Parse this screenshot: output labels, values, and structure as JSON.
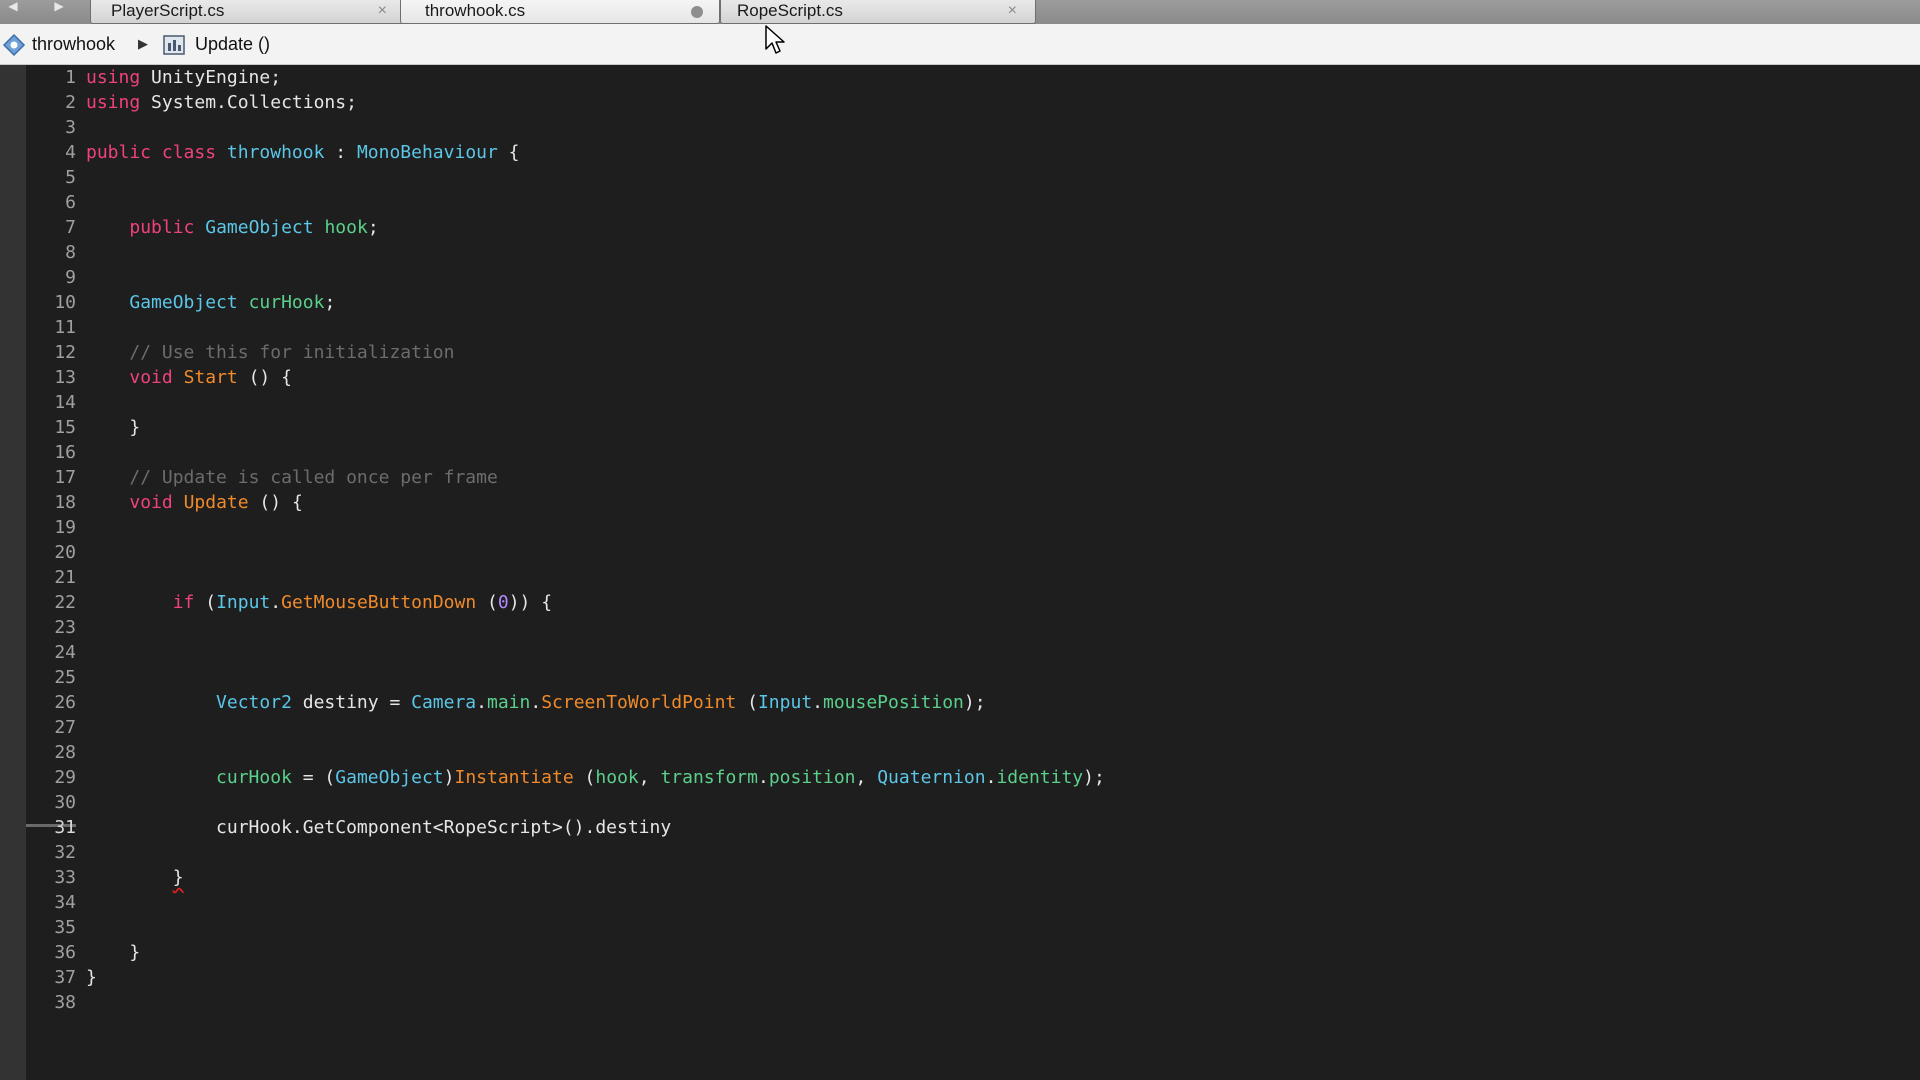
{
  "tabs": [
    {
      "label": "PlayerScript.cs",
      "close": "×"
    },
    {
      "label": "throwhook.cs",
      "modified": true
    },
    {
      "label": "RopeScript.cs",
      "close": "×"
    }
  ],
  "nav": {
    "back": "◀",
    "forward": "▶"
  },
  "breadcrumb": {
    "class_name": "throwhook",
    "separator": "▶",
    "method_name": "Update ()"
  },
  "icons": {
    "class_icon": "class-icon",
    "method_icon": "method-icon"
  },
  "colors": {
    "keyword": "#f0427a",
    "type": "#5bc6e6",
    "method": "#f08a2a",
    "field": "#5ad08b",
    "comment": "#6c6c6c",
    "number": "#b388ff"
  },
  "editor": {
    "current_line": 31,
    "lines": [
      [
        {
          "c": "k",
          "t": "using"
        },
        {
          "c": "p",
          "t": " UnityEngine;"
        }
      ],
      [
        {
          "c": "k",
          "t": "using"
        },
        {
          "c": "p",
          "t": " System.Collections;"
        }
      ],
      [],
      [
        {
          "c": "k",
          "t": "public class"
        },
        {
          "c": "p",
          "t": " "
        },
        {
          "c": "t",
          "t": "throwhook"
        },
        {
          "c": "p",
          "t": " : "
        },
        {
          "c": "t",
          "t": "MonoBehaviour"
        },
        {
          "c": "p",
          "t": " {"
        }
      ],
      [],
      [],
      [
        {
          "c": "p",
          "t": "    "
        },
        {
          "c": "k",
          "t": "public"
        },
        {
          "c": "p",
          "t": " "
        },
        {
          "c": "t",
          "t": "GameObject"
        },
        {
          "c": "p",
          "t": " "
        },
        {
          "c": "f",
          "t": "hook"
        },
        {
          "c": "p",
          "t": ";"
        }
      ],
      [],
      [],
      [
        {
          "c": "p",
          "t": "    "
        },
        {
          "c": "t",
          "t": "GameObject"
        },
        {
          "c": "p",
          "t": " "
        },
        {
          "c": "f",
          "t": "curHook"
        },
        {
          "c": "p",
          "t": ";"
        }
      ],
      [],
      [
        {
          "c": "p",
          "t": "    "
        },
        {
          "c": "c",
          "t": "// Use this for initialization"
        }
      ],
      [
        {
          "c": "p",
          "t": "    "
        },
        {
          "c": "k",
          "t": "void"
        },
        {
          "c": "p",
          "t": " "
        },
        {
          "c": "m",
          "t": "Start"
        },
        {
          "c": "p",
          "t": " () {"
        }
      ],
      [],
      [
        {
          "c": "p",
          "t": "    }"
        }
      ],
      [],
      [
        {
          "c": "p",
          "t": "    "
        },
        {
          "c": "c",
          "t": "// Update is called once per frame"
        }
      ],
      [
        {
          "c": "p",
          "t": "    "
        },
        {
          "c": "k",
          "t": "void"
        },
        {
          "c": "p",
          "t": " "
        },
        {
          "c": "m",
          "t": "Update"
        },
        {
          "c": "p",
          "t": " () {"
        }
      ],
      [],
      [],
      [],
      [
        {
          "c": "p",
          "t": "        "
        },
        {
          "c": "k",
          "t": "if"
        },
        {
          "c": "p",
          "t": " ("
        },
        {
          "c": "t",
          "t": "Input"
        },
        {
          "c": "p",
          "t": "."
        },
        {
          "c": "m",
          "t": "GetMouseButtonDown"
        },
        {
          "c": "p",
          "t": " ("
        },
        {
          "c": "n",
          "t": "0"
        },
        {
          "c": "p",
          "t": ")) {"
        }
      ],
      [],
      [],
      [],
      [
        {
          "c": "p",
          "t": "            "
        },
        {
          "c": "t",
          "t": "Vector2"
        },
        {
          "c": "p",
          "t": " destiny = "
        },
        {
          "c": "t",
          "t": "Camera"
        },
        {
          "c": "p",
          "t": "."
        },
        {
          "c": "f",
          "t": "main"
        },
        {
          "c": "p",
          "t": "."
        },
        {
          "c": "m",
          "t": "ScreenToWorldPoint"
        },
        {
          "c": "p",
          "t": " ("
        },
        {
          "c": "t",
          "t": "Input"
        },
        {
          "c": "p",
          "t": "."
        },
        {
          "c": "f",
          "t": "mousePosition"
        },
        {
          "c": "p",
          "t": ");"
        }
      ],
      [],
      [],
      [
        {
          "c": "p",
          "t": "            "
        },
        {
          "c": "f",
          "t": "curHook"
        },
        {
          "c": "p",
          "t": " = ("
        },
        {
          "c": "t",
          "t": "GameObject"
        },
        {
          "c": "p",
          "t": ")"
        },
        {
          "c": "m",
          "t": "Instantiate"
        },
        {
          "c": "p",
          "t": " ("
        },
        {
          "c": "f",
          "t": "hook"
        },
        {
          "c": "p",
          "t": ", "
        },
        {
          "c": "f",
          "t": "transform"
        },
        {
          "c": "p",
          "t": "."
        },
        {
          "c": "f",
          "t": "position"
        },
        {
          "c": "p",
          "t": ", "
        },
        {
          "c": "t",
          "t": "Quaternion"
        },
        {
          "c": "p",
          "t": "."
        },
        {
          "c": "f",
          "t": "identity"
        },
        {
          "c": "p",
          "t": ");"
        }
      ],
      [],
      [
        {
          "c": "p",
          "t": "            curHook.GetComponent<RopeScript>().destiny"
        }
      ],
      [],
      [
        {
          "c": "p",
          "t": "        "
        },
        {
          "c": "p squiggle",
          "t": "}"
        }
      ],
      [],
      [],
      [
        {
          "c": "p",
          "t": "    }"
        }
      ],
      [
        {
          "c": "p",
          "t": "}"
        }
      ],
      []
    ]
  }
}
